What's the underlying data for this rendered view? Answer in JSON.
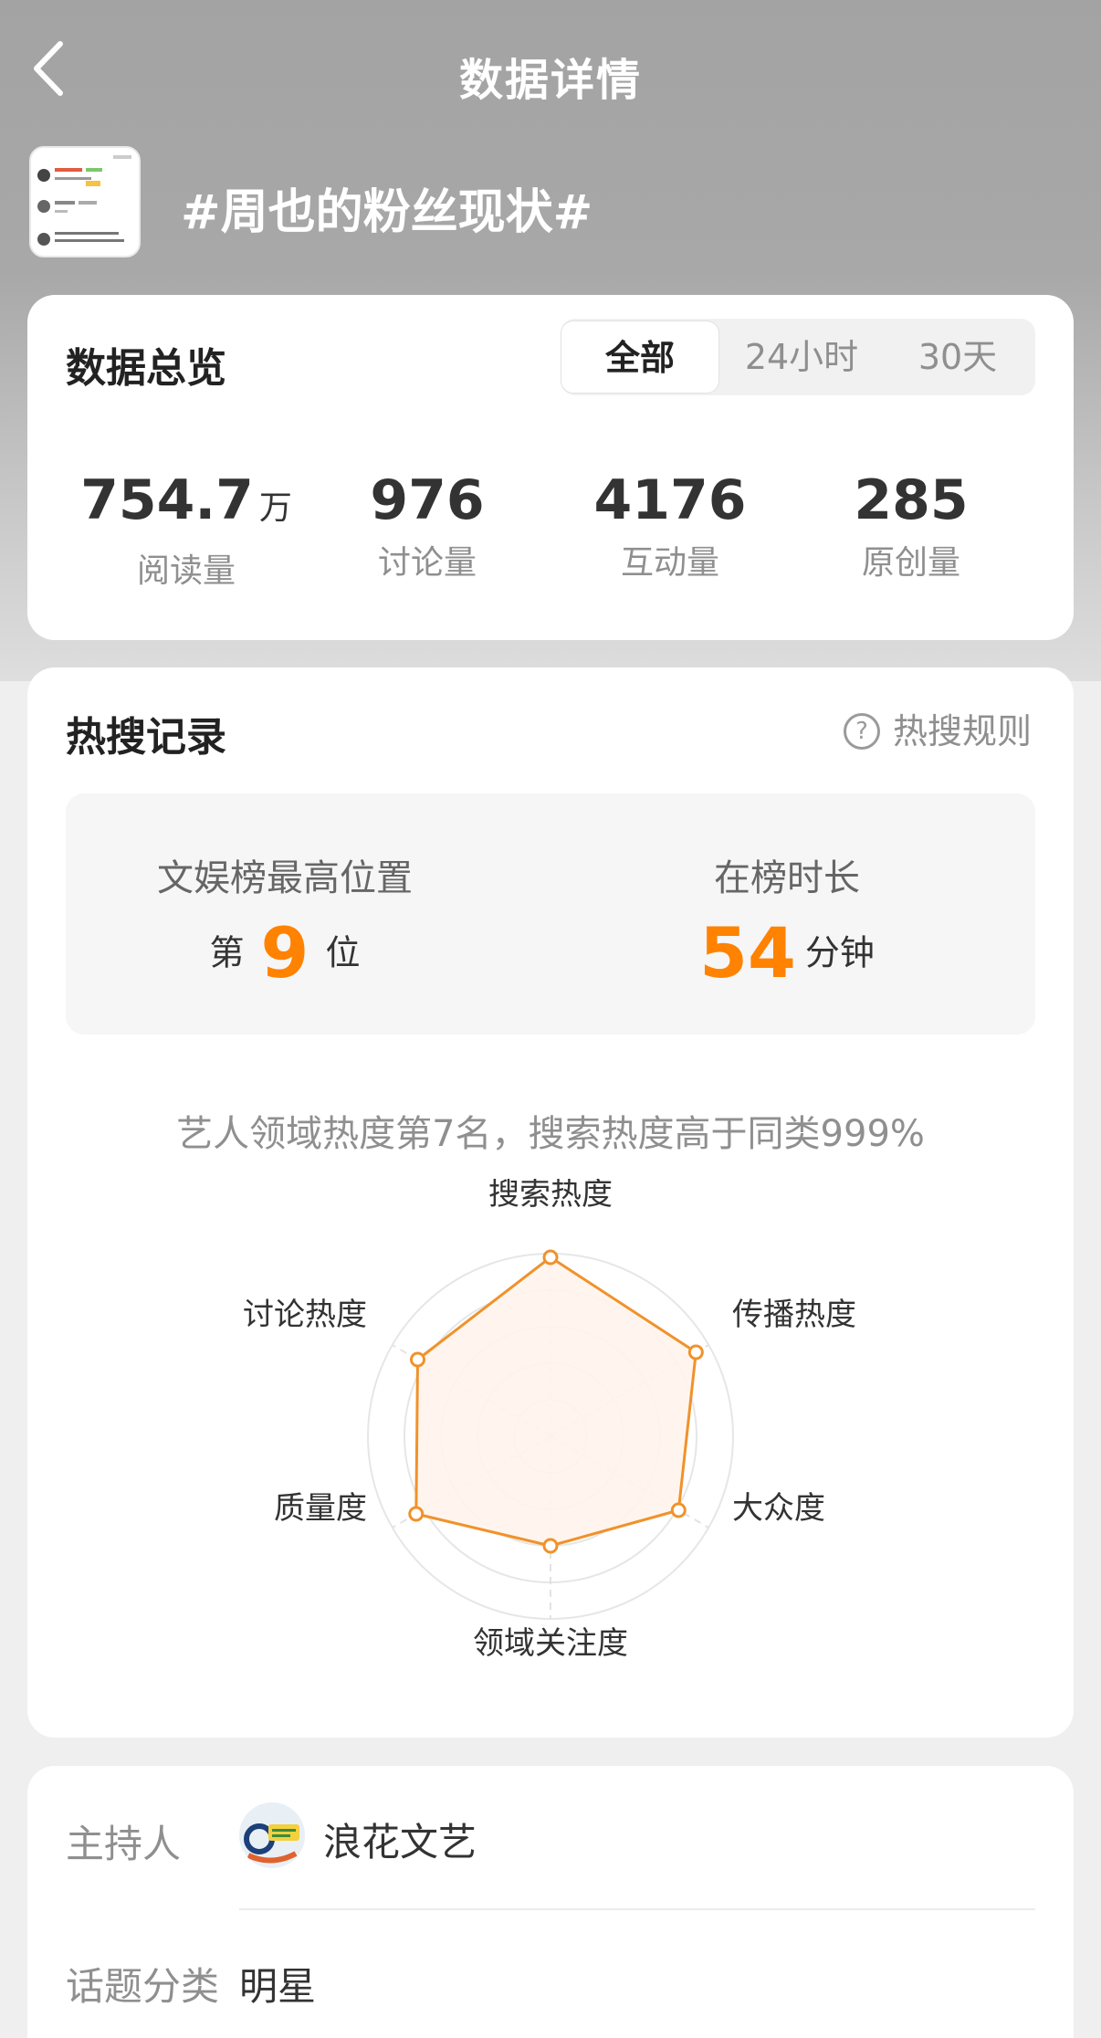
{
  "nav": {
    "title": "数据详情"
  },
  "topic": {
    "title": "#周也的粉丝现状#"
  },
  "overview": {
    "title": "数据总览",
    "tabs": [
      "全部",
      "24小时",
      "30天"
    ],
    "active_tab": "全部",
    "stats": [
      {
        "value": "754.7",
        "unit": "万",
        "label": "阅读量"
      },
      {
        "value": "976",
        "unit": "",
        "label": "讨论量"
      },
      {
        "value": "4176",
        "unit": "",
        "label": "互动量"
      },
      {
        "value": "285",
        "unit": "",
        "label": "原创量"
      }
    ]
  },
  "hot_search": {
    "title": "热搜记录",
    "rule_icon": "?",
    "rule_label": "热搜规则",
    "best_position": {
      "label": "文娱榜最高位置",
      "prefix": "第",
      "value": "9",
      "suffix": "位"
    },
    "duration": {
      "label": "在榜时长",
      "value": "54",
      "suffix": "分钟"
    },
    "summary": "艺人领域热度第7名，搜索热度高于同类999%",
    "radar": {
      "axes": [
        "搜索热度",
        "传播热度",
        "大众度",
        "领域关注度",
        "质量度",
        "讨论热度"
      ],
      "values": [
        0.98,
        0.92,
        0.81,
        0.6,
        0.85,
        0.84
      ],
      "accent": "#f0922b",
      "fill": "#fff4ec"
    }
  },
  "info": {
    "host_label": "主持人",
    "host_name": "浪花文艺",
    "category_label": "话题分类",
    "category_value": "明星"
  }
}
